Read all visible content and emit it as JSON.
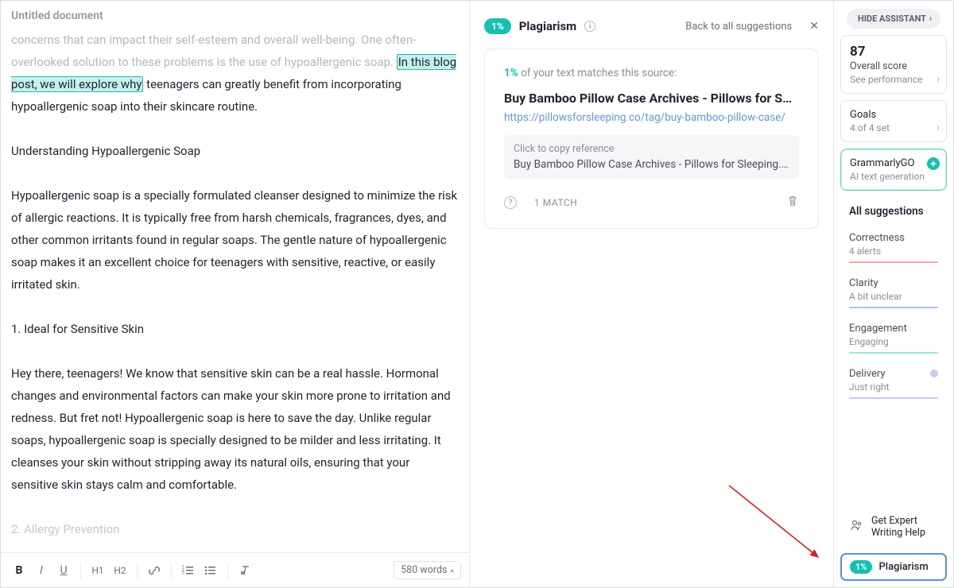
{
  "doc_title": "Untitled document",
  "editor": {
    "faded_opening": "concerns that can impact their self-esteem and overall well-being. One often-overlooked solution to these problems is the use of hypoallergenic soap. ",
    "highlighted": "In this blog post, we will explore why",
    "after_highlight": " teenagers can greatly benefit from incorporating hypoallergenic soap into their skincare routine.",
    "p2": "Understanding Hypoallergenic Soap",
    "p3": "Hypoallergenic soap is a specially formulated cleanser designed to minimize the risk of allergic reactions. It is typically free from harsh chemicals, fragrances, dyes, and other common irritants found in regular soaps. The gentle nature of hypoallergenic soap makes it an excellent choice for teenagers with sensitive, reactive, or easily irritated skin.",
    "p4": "1. Ideal for Sensitive Skin",
    "p5": "Hey there, teenagers! We know that sensitive skin can be a real hassle. Hormonal changes and environmental factors can make your skin more prone to irritation and redness. But fret not! Hypoallergenic soap is here to save the day. Unlike regular soaps, hypoallergenic soap is specially designed to be milder and less irritating. It cleanses your skin without stripping away its natural oils, ensuring that your sensitive skin stays calm and comfortable.",
    "p6_faded": "2. Allergy Prevention"
  },
  "toolbar": {
    "h1": "H1",
    "h2": "H2",
    "word_count": "580 words"
  },
  "suggest": {
    "badge": "1%",
    "title": "Plagiarism",
    "back": "Back to all suggestions",
    "card": {
      "pct": "1%",
      "pct_suffix": " of your text matches this source:",
      "source_title": "Buy Bamboo Pillow Case Archives - Pillows for S…",
      "source_url": "https://pillowsforsleeping.co/tag/buy-bamboo-pillow-case/",
      "ref_label": "Click to copy reference",
      "ref_text": "Buy Bamboo Pillow Case Archives - Pillows for Sleeping. http…",
      "match_count": "1 MATCH"
    }
  },
  "side": {
    "hide": "HIDE ASSISTANT",
    "score": {
      "num": "87",
      "l1": "Overall score",
      "l2": "See performance"
    },
    "goals": {
      "t": "Goals",
      "s": "4 of 4 set"
    },
    "ggo": {
      "t": "GrammarlyGO",
      "s": "AI text generation"
    },
    "all": "All suggestions",
    "items": [
      {
        "t": "Correctness",
        "s": "4 alerts"
      },
      {
        "t": "Clarity",
        "s": "A bit unclear"
      },
      {
        "t": "Engagement",
        "s": "Engaging"
      },
      {
        "t": "Delivery",
        "s": "Just right"
      }
    ],
    "expert": "Get Expert Writing Help",
    "plag": {
      "pct": "1%",
      "label": "Plagiarism"
    }
  }
}
